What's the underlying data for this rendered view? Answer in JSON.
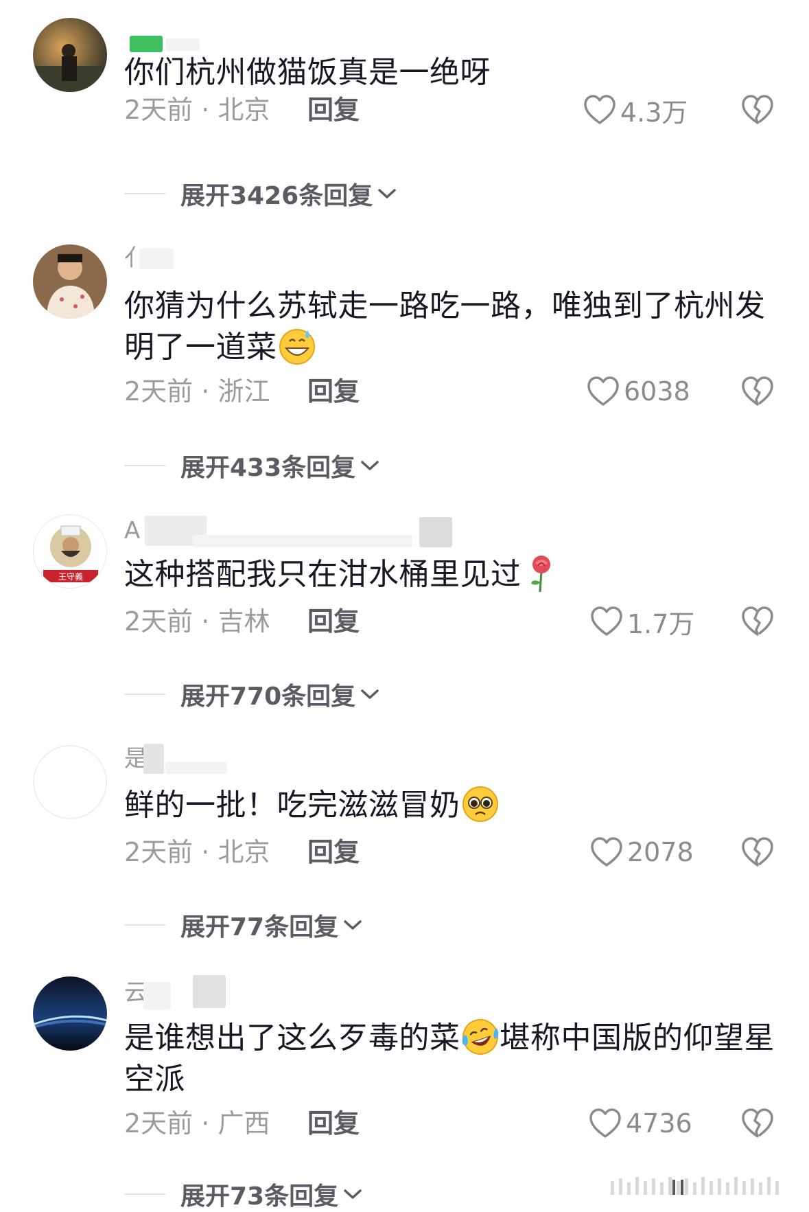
{
  "comments": [
    {
      "username": "",
      "text": "你们杭州做猫饭真是一绝呀",
      "emoji": "",
      "time": "2天前",
      "location": "北京",
      "reply": "回复",
      "likes": "4.3万",
      "expand": "展开3426条回复"
    },
    {
      "username": "亻",
      "text": "你猜为什么苏轼走一路吃一路，唯独到了杭州发明了一道菜",
      "emoji": "grinning-sweat-emoji",
      "time": "2天前",
      "location": "浙江",
      "reply": "回复",
      "likes": "6038",
      "expand": "展开433条回复"
    },
    {
      "username": "A",
      "text": "这种搭配我只在泔水桶里见过",
      "emoji": "rose-emoji",
      "time": "2天前",
      "location": "吉林",
      "reply": "回复",
      "likes": "1.7万",
      "expand": "展开770条回复"
    },
    {
      "username": "是",
      "text": "鲜的一批！吃完滋滋冒奶",
      "emoji": "pleading-face-emoji",
      "time": "2天前",
      "location": "北京",
      "reply": "回复",
      "likes": "2078",
      "expand": "展开77条回复"
    },
    {
      "username": "云",
      "text_before": "是谁想出了这么歹毒的菜",
      "text_after": "堪称中国版的仰望星空派",
      "emoji": "laughing-crying-emoji",
      "time": "2天前",
      "location": "广西",
      "reply": "回复",
      "likes": "4736",
      "expand": "展开73条回复"
    }
  ],
  "separator": " · ",
  "colors": {
    "meta": "#9a9ba1",
    "text": "#161823",
    "action": "#5b5c63"
  }
}
